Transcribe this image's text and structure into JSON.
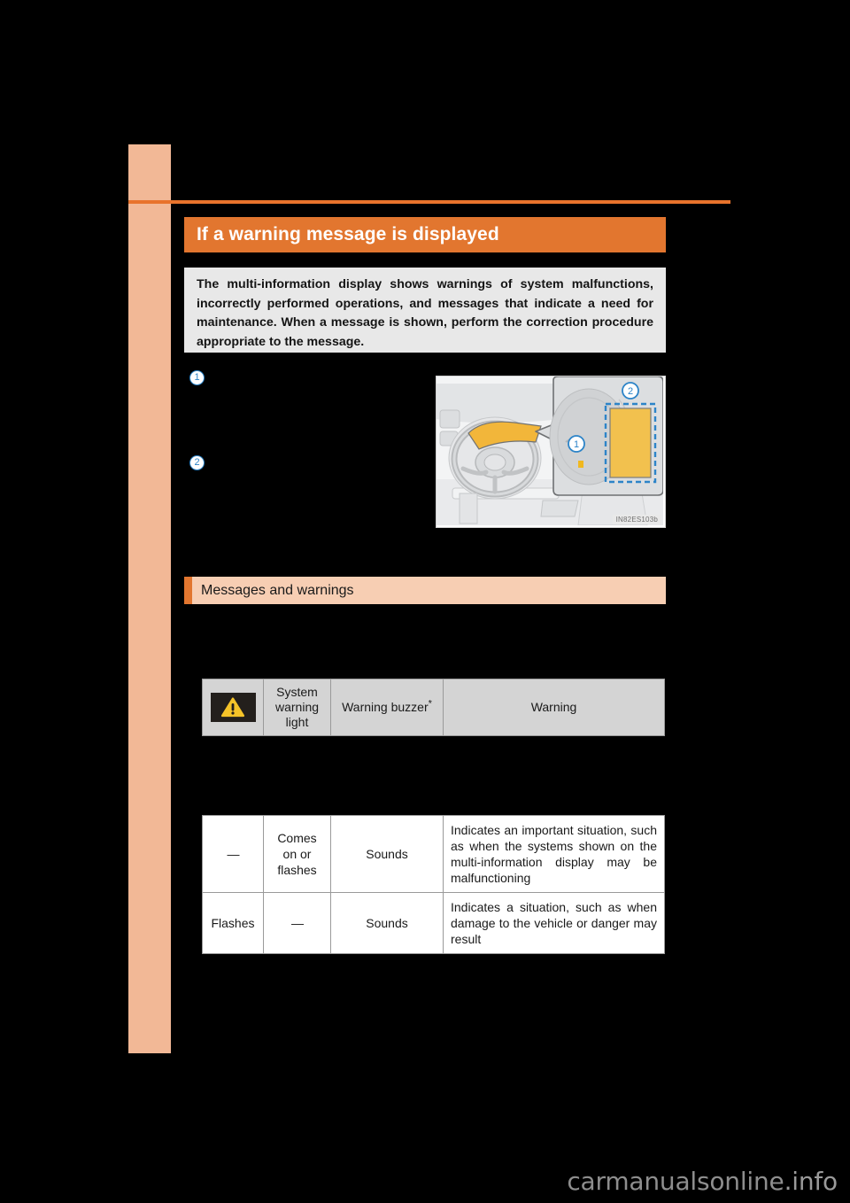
{
  "section": {
    "title": "If a warning message is displayed",
    "lead_paragraph": "The multi-information display shows warnings of system malfunctions, incorrectly performed operations, and messages that indicate a need for maintenance. When a message is shown, perform the correction procedure appropriate to the message."
  },
  "callouts": [
    {
      "number": "1",
      "text": ""
    },
    {
      "number": "2",
      "text": ""
    }
  ],
  "figure": {
    "code": "IN82ES103b",
    "callout_1": "1",
    "callout_2": "2",
    "alt": "Driver dashboard with steering wheel and magnified instrument cluster inset"
  },
  "subsection": {
    "title": "Messages and warnings"
  },
  "header_table": {
    "icon": "warning-triangle-icon",
    "columns": [
      "",
      "System warning light",
      "Warning buzzer",
      "Warning"
    ],
    "buzzer_footnote_marker": "*"
  },
  "data_table": {
    "rows": [
      {
        "system_warning_light": "—",
        "comes_on": "Comes on or flashes",
        "buzzer": "Sounds",
        "warning": "Indicates an important situation, such as when the systems shown on the multi-information display may be malfunctioning"
      },
      {
        "system_warning_light": "Flashes",
        "comes_on": "—",
        "buzzer": "Sounds",
        "warning": "Indicates a situation, such as when damage to the vehicle or danger may result"
      }
    ]
  },
  "watermark": {
    "name": "carmanualsonline",
    "tld": ".info"
  },
  "colors": {
    "accent_orange": "#e2762f",
    "rule_orange": "#e8732c",
    "tab_peach": "#f2b896",
    "subsection_peach": "#f7ceb3",
    "lead_grey": "#e8e8e8",
    "table_header_grey": "#d4d4d4",
    "callout_blue": "#2d84c8",
    "warning_yellow": "#f5c329",
    "page_black": "#000000"
  }
}
